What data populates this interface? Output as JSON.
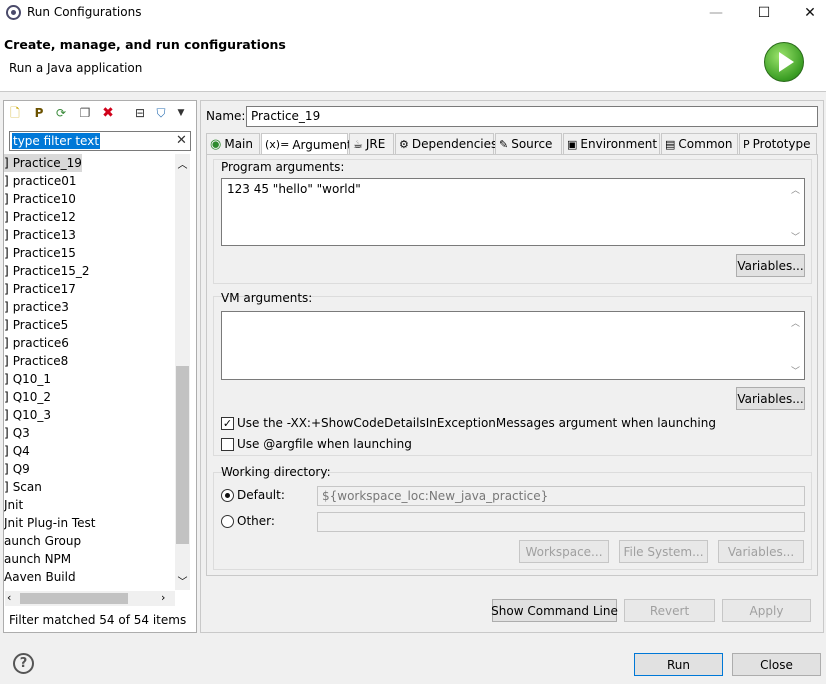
{
  "window": {
    "title": "Run Configurations",
    "minimize": "—",
    "maximize": "☐",
    "close": "✕"
  },
  "banner": {
    "title": "Create, manage, and run configurations",
    "subtitle": "Run a Java application",
    "icon": "run-play-icon"
  },
  "left": {
    "toolbar_icons": [
      "new-configuration-icon",
      "new-prototype-icon",
      "export-icon",
      "duplicate-icon",
      "delete-icon",
      "collapse-all-icon",
      "filter-icon",
      "view-menu-icon"
    ],
    "filter": {
      "value": "type filter text",
      "clear": "✕"
    },
    "tree_items": [
      {
        "label": "Practice_19",
        "prefix": "]",
        "selected": true
      },
      {
        "label": "practice01",
        "prefix": "]"
      },
      {
        "label": "Practice10",
        "prefix": "]"
      },
      {
        "label": "Practice12",
        "prefix": "]"
      },
      {
        "label": "Practice13",
        "prefix": "]"
      },
      {
        "label": "Practice15",
        "prefix": "]"
      },
      {
        "label": "Practice15_2",
        "prefix": "]"
      },
      {
        "label": "Practice17",
        "prefix": "]"
      },
      {
        "label": "practice3",
        "prefix": "]"
      },
      {
        "label": "Practice5",
        "prefix": "]"
      },
      {
        "label": "practice6",
        "prefix": "]"
      },
      {
        "label": "Practice8",
        "prefix": "]"
      },
      {
        "label": "Q10_1",
        "prefix": "]"
      },
      {
        "label": "Q10_2",
        "prefix": "]"
      },
      {
        "label": "Q10_3",
        "prefix": "]"
      },
      {
        "label": "Q3",
        "prefix": "]"
      },
      {
        "label": "Q4",
        "prefix": "]"
      },
      {
        "label": "Q9",
        "prefix": "]"
      },
      {
        "label": "Scan",
        "prefix": "]"
      },
      {
        "label": "Jnit",
        "prefix": ""
      },
      {
        "label": "Jnit Plug-in Test",
        "prefix": ""
      },
      {
        "label": "aunch Group",
        "prefix": ""
      },
      {
        "label": "aunch NPM",
        "prefix": ""
      },
      {
        "label": "Aaven Build",
        "prefix": ""
      }
    ],
    "status": "Filter matched 54 of 54 items"
  },
  "right": {
    "name_label": "Name:",
    "name_value": "Practice_19",
    "tabs": [
      {
        "label": "Main",
        "icon": "main-tab-icon",
        "glyph": "◉",
        "active": false
      },
      {
        "label": "Arguments",
        "icon": "arguments-tab-icon",
        "glyph": "(x)=",
        "active": true
      },
      {
        "label": "JRE",
        "icon": "jre-tab-icon",
        "glyph": "☕",
        "active": false
      },
      {
        "label": "Dependencies",
        "icon": "dependencies-tab-icon",
        "glyph": "⚙",
        "active": false
      },
      {
        "label": "Source",
        "icon": "source-tab-icon",
        "glyph": "✎",
        "active": false
      },
      {
        "label": "Environment",
        "icon": "environment-tab-icon",
        "glyph": "▣",
        "active": false
      },
      {
        "label": "Common",
        "icon": "common-tab-icon",
        "glyph": "▤",
        "active": false
      },
      {
        "label": "Prototype",
        "icon": "prototype-tab-icon",
        "glyph": "P",
        "active": false
      }
    ],
    "program_args": {
      "label": "Program arguments:",
      "value": "123 45 \"hello\" \"world\"",
      "variables_btn": "Variables..."
    },
    "vm_args": {
      "label": "VM arguments:",
      "value": "",
      "variables_btn": "Variables..."
    },
    "checkboxes": [
      {
        "label": "Use the -XX:+ShowCodeDetailsInExceptionMessages argument when launching",
        "checked": true
      },
      {
        "label": "Use @argfile when launching",
        "checked": false
      }
    ],
    "working_dir": {
      "label": "Working directory:",
      "default_label": "Default:",
      "default_value": "${workspace_loc:New_java_practice}",
      "other_label": "Other:",
      "other_value": "",
      "selected": "default",
      "buttons": [
        "Workspace...",
        "File System...",
        "Variables..."
      ]
    },
    "bottom_buttons": {
      "show_command_line": "Show Command Line",
      "revert": "Revert",
      "apply": "Apply"
    }
  },
  "footer": {
    "help": "?",
    "run": "Run",
    "close": "Close"
  }
}
